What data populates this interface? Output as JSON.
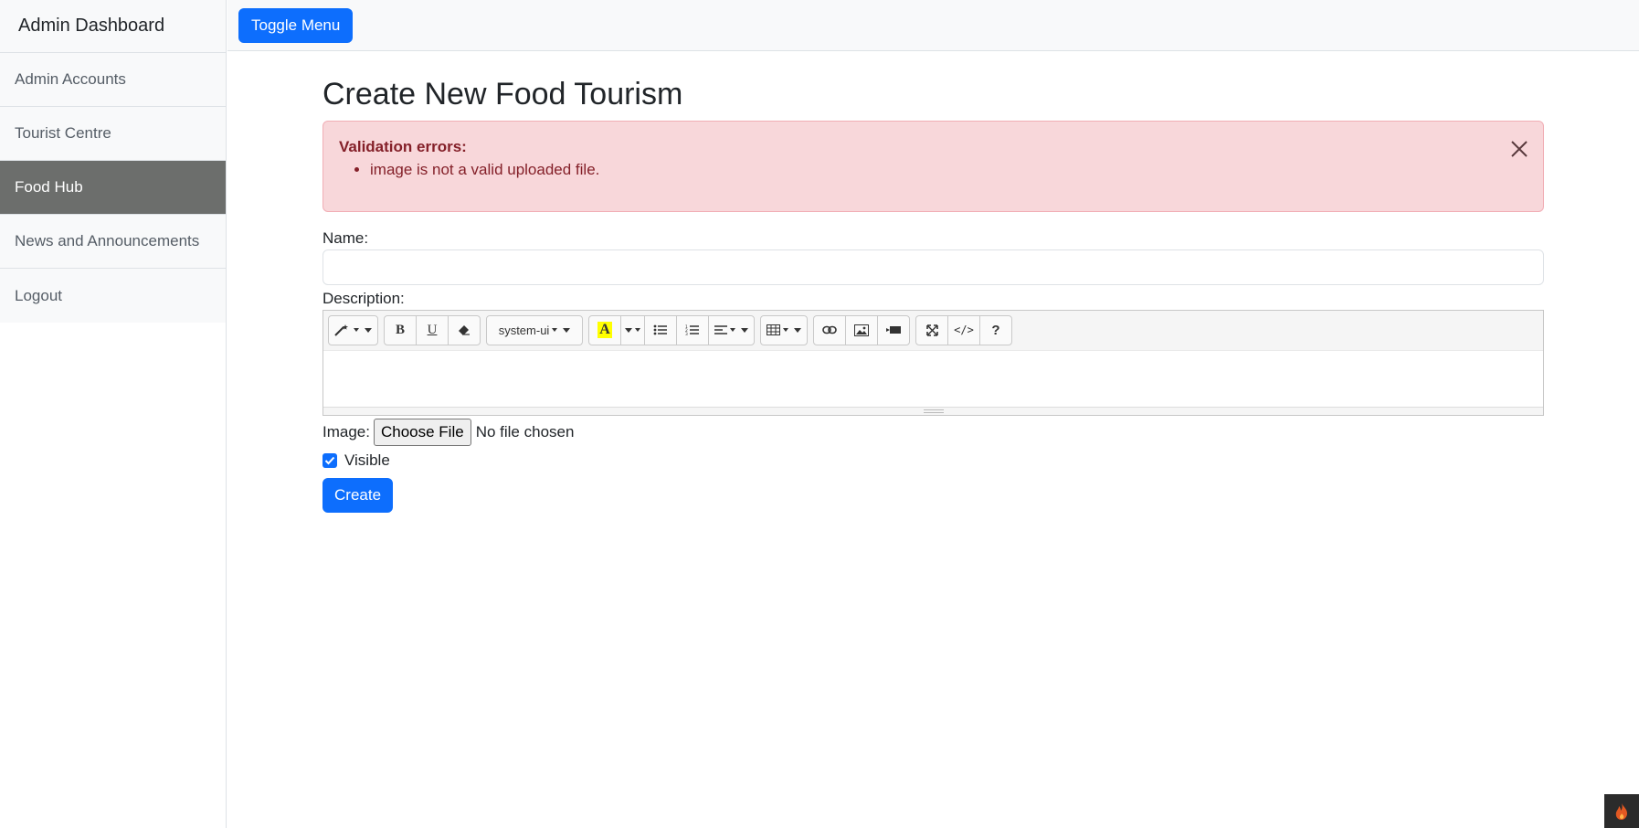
{
  "sidebar": {
    "heading": "Admin Dashboard",
    "items": [
      {
        "label": "Admin Accounts",
        "active": false
      },
      {
        "label": "Tourist Centre",
        "active": false
      },
      {
        "label": "Food Hub",
        "active": true
      },
      {
        "label": "News and Announcements",
        "active": false
      },
      {
        "label": "Logout",
        "active": false
      }
    ]
  },
  "topbar": {
    "toggle_label": "Toggle Menu"
  },
  "main": {
    "title": "Create New Food Tourism",
    "alert": {
      "title": "Validation errors:",
      "errors": [
        "image is not a valid uploaded file."
      ]
    },
    "name_label": "Name:",
    "name_value": "",
    "description_label": "Description:",
    "editor": {
      "font_name": "system-ui"
    },
    "image_label": "Image:",
    "file_button": "Choose File",
    "file_status": "No file chosen",
    "visible_label": "Visible",
    "visible_checked": true,
    "create_label": "Create"
  },
  "colors": {
    "primary": "#0d6efd",
    "sidebar_active": "#6c6e6c",
    "alert_bg": "#f8d7da",
    "alert_text": "#842029"
  }
}
